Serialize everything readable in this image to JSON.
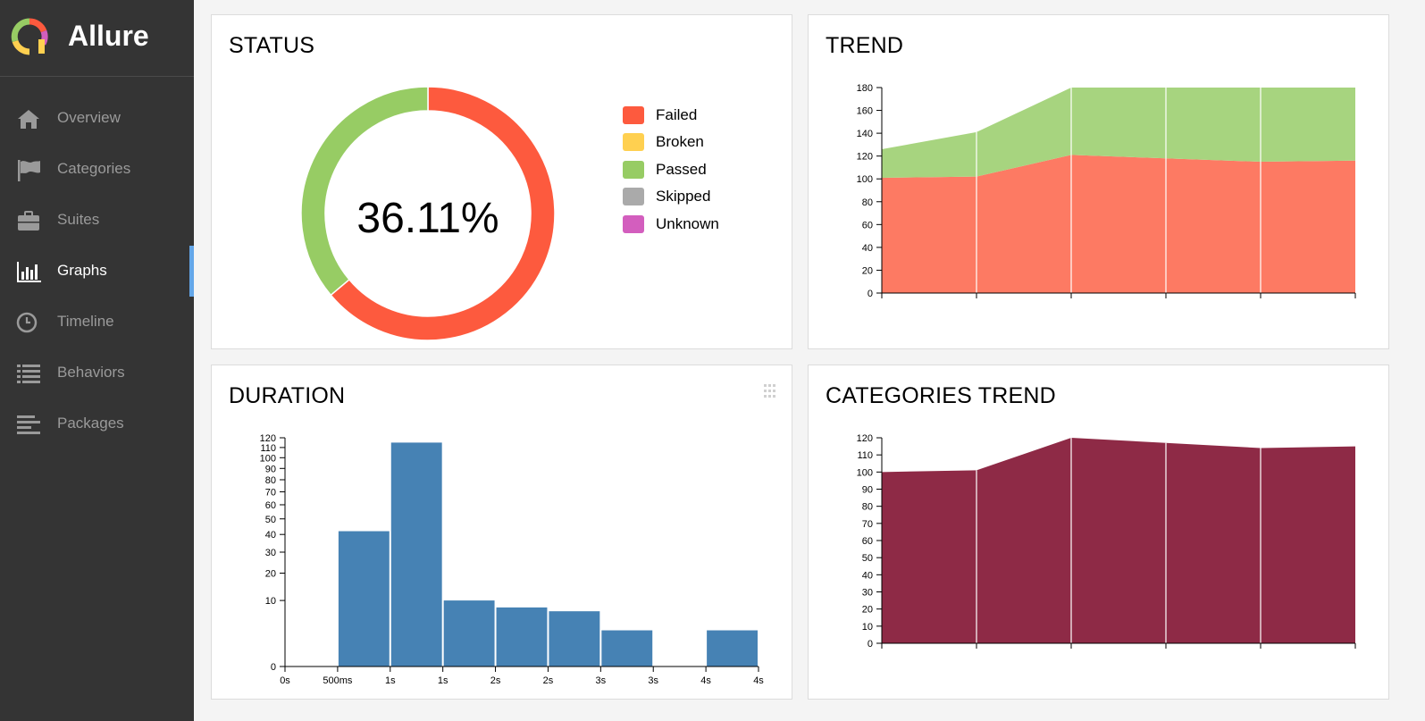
{
  "app": {
    "name": "Allure"
  },
  "sidebar": {
    "items": [
      {
        "label": "Overview",
        "icon": "home-icon"
      },
      {
        "label": "Categories",
        "icon": "flag-icon"
      },
      {
        "label": "Suites",
        "icon": "briefcase-icon"
      },
      {
        "label": "Graphs",
        "icon": "bar-chart-icon",
        "active": true
      },
      {
        "label": "Timeline",
        "icon": "clock-icon"
      },
      {
        "label": "Behaviors",
        "icon": "list-icon"
      },
      {
        "label": "Packages",
        "icon": "align-left-icon"
      }
    ],
    "active_indicator_color": "#64a7e9"
  },
  "status": {
    "title": "STATUS",
    "percent_text": "36.11%",
    "legend": [
      {
        "label": "Failed",
        "color": "#fd5a3e"
      },
      {
        "label": "Broken",
        "color": "#ffd050"
      },
      {
        "label": "Passed",
        "color": "#97cc64"
      },
      {
        "label": "Skipped",
        "color": "#aaaaaa"
      },
      {
        "label": "Unknown",
        "color": "#d35ebe"
      }
    ]
  },
  "trend": {
    "title": "TREND"
  },
  "duration": {
    "title": "DURATION"
  },
  "categories_trend": {
    "title": "CATEGORIES TREND"
  },
  "chart_data": [
    {
      "type": "pie",
      "title": "STATUS",
      "center_label": "36.11%",
      "categories": [
        "Failed",
        "Broken",
        "Passed",
        "Skipped",
        "Unknown"
      ],
      "values": [
        63.89,
        0,
        36.11,
        0,
        0
      ],
      "colors": [
        "#fd5a3e",
        "#ffd050",
        "#97cc64",
        "#aaaaaa",
        "#d35ebe"
      ]
    },
    {
      "type": "area",
      "title": "TREND",
      "x": [
        1,
        2,
        3,
        4,
        5,
        6
      ],
      "ylim": [
        0,
        180
      ],
      "yticks": [
        0,
        20,
        40,
        60,
        80,
        100,
        120,
        140,
        160,
        180
      ],
      "series": [
        {
          "name": "failed",
          "color": "#fd7a63",
          "values": [
            101,
            102,
            121,
            118,
            115,
            116
          ]
        },
        {
          "name": "passed",
          "color": "#a7d47f",
          "values": [
            25,
            39,
            59,
            62,
            65,
            64
          ]
        }
      ]
    },
    {
      "type": "bar",
      "title": "DURATION",
      "color": "#4682b4",
      "xticks": [
        "0s",
        "500ms",
        "1s",
        "1s",
        "2s",
        "2s",
        "3s",
        "3s",
        "4s",
        "4s"
      ],
      "yscale": "sqrt",
      "ylim": [
        0,
        120
      ],
      "yticks": [
        0,
        10,
        20,
        30,
        40,
        50,
        60,
        70,
        80,
        90,
        100,
        110,
        120
      ],
      "values": [
        0,
        42,
        115,
        10,
        8,
        7,
        3,
        0,
        3
      ]
    },
    {
      "type": "area",
      "title": "CATEGORIES TREND",
      "x": [
        1,
        2,
        3,
        4,
        5,
        6
      ],
      "ylim": [
        0,
        120
      ],
      "yticks": [
        0,
        10,
        20,
        30,
        40,
        50,
        60,
        70,
        80,
        90,
        100,
        110,
        120
      ],
      "series": [
        {
          "name": "",
          "color": "#8e2a46",
          "values": [
            100,
            101,
            120,
            117,
            114,
            115
          ]
        }
      ]
    }
  ]
}
